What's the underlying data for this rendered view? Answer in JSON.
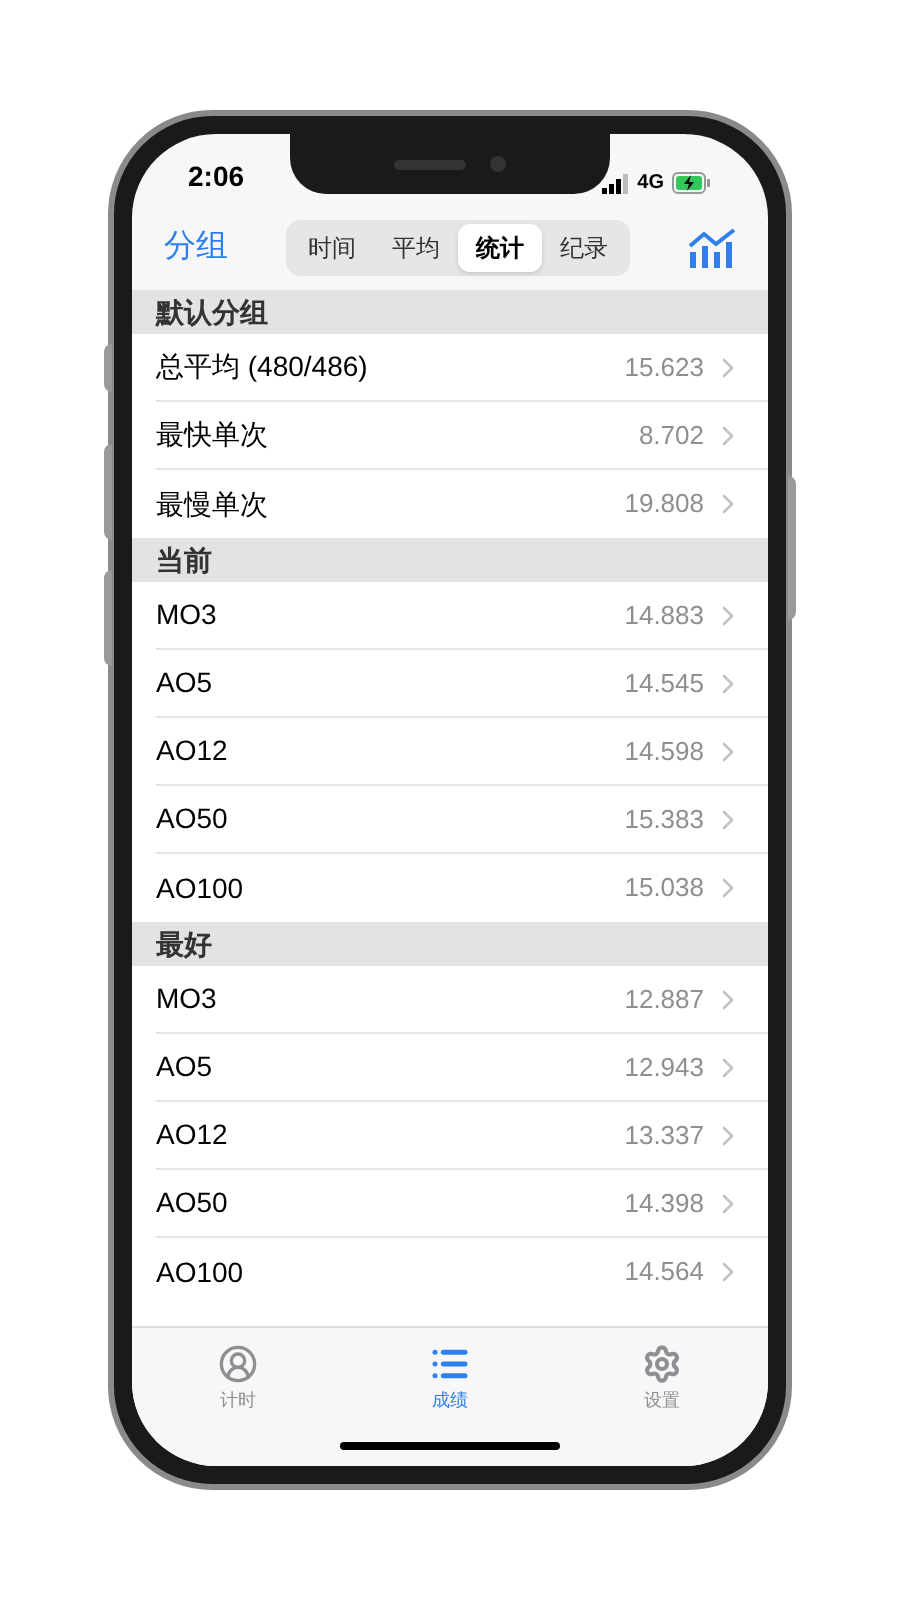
{
  "status_bar": {
    "time": "2:06",
    "network": "4G",
    "charging": true
  },
  "nav": {
    "back": "分组",
    "segments": [
      {
        "label": "时间",
        "selected": false
      },
      {
        "label": "平均",
        "selected": false
      },
      {
        "label": "统计",
        "selected": true
      },
      {
        "label": "纪录",
        "selected": false
      }
    ]
  },
  "sections": [
    {
      "title": "默认分组",
      "rows": [
        {
          "label": "总平均 (480/486)",
          "value": "15.623"
        },
        {
          "label": "最快单次",
          "value": "8.702"
        },
        {
          "label": "最慢单次",
          "value": "19.808"
        }
      ]
    },
    {
      "title": "当前",
      "rows": [
        {
          "label": "MO3",
          "value": "14.883"
        },
        {
          "label": "AO5",
          "value": "14.545"
        },
        {
          "label": "AO12",
          "value": "14.598"
        },
        {
          "label": "AO50",
          "value": "15.383"
        },
        {
          "label": "AO100",
          "value": "15.038"
        }
      ]
    },
    {
      "title": "最好",
      "rows": [
        {
          "label": "MO3",
          "value": "12.887"
        },
        {
          "label": "AO5",
          "value": "12.943"
        },
        {
          "label": "AO12",
          "value": "13.337"
        },
        {
          "label": "AO50",
          "value": "14.398"
        },
        {
          "label": "AO100",
          "value": "14.564"
        }
      ]
    }
  ],
  "tab_bar": [
    {
      "kind": "timer",
      "label": "计时",
      "selected": false
    },
    {
      "kind": "list",
      "label": "成绩",
      "selected": true
    },
    {
      "kind": "gear",
      "label": "设置",
      "selected": false
    }
  ]
}
